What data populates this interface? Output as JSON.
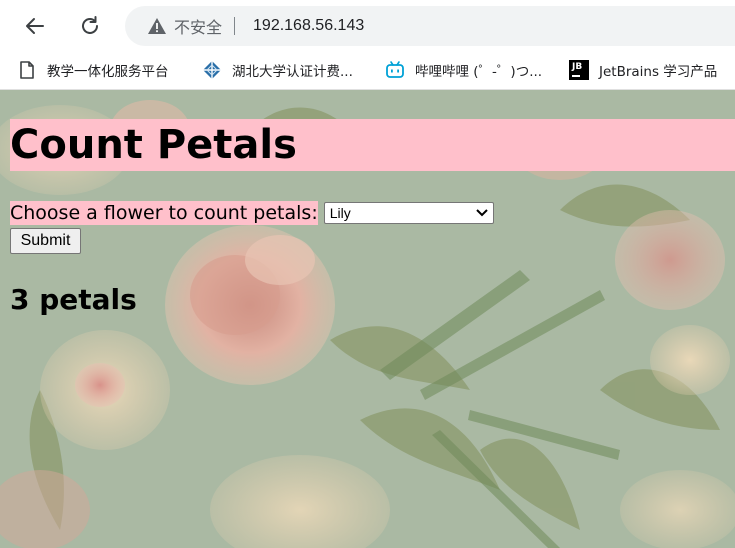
{
  "browser": {
    "security_label": "不安全",
    "url": "192.168.56.143",
    "bookmarks": [
      {
        "label": "教学一体化服务平台",
        "icon": "document-icon"
      },
      {
        "label": "湖北大学认证计费...",
        "icon": "diamond-logo-icon"
      },
      {
        "label": "哔哩哔哩 (゜-゜)つ...",
        "icon": "bilibili-icon"
      },
      {
        "label": "JetBrains 学习产品",
        "icon": "jetbrains-icon"
      }
    ]
  },
  "page": {
    "title": "Count Petals",
    "form_label": "Choose a flower to count petals:",
    "selected_flower": "Lily",
    "submit_label": "Submit",
    "result": "3 petals"
  },
  "colors": {
    "highlight": "#ffc0cb",
    "wallpaper_base": "#a9b8a2"
  }
}
